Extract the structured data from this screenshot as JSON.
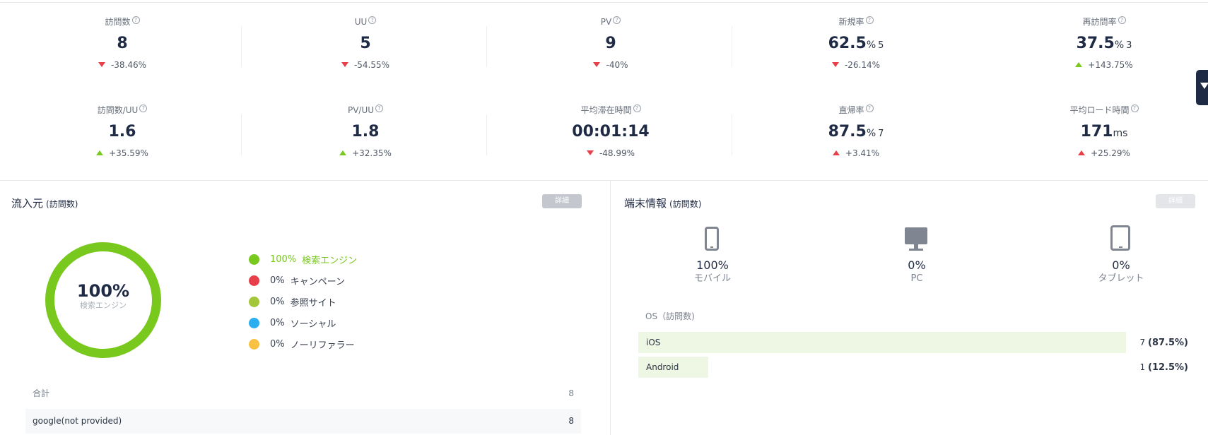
{
  "metrics": [
    {
      "label": "訪問数",
      "value": "8",
      "unit": "",
      "count": "",
      "change": "-38.46%",
      "trend": "down"
    },
    {
      "label": "UU",
      "value": "5",
      "unit": "",
      "count": "",
      "change": "-54.55%",
      "trend": "down"
    },
    {
      "label": "PV",
      "value": "9",
      "unit": "",
      "count": "",
      "change": "-40%",
      "trend": "down"
    },
    {
      "label": "新規率",
      "value": "62.5",
      "unit": "%",
      "count": "5",
      "change": "-26.14%",
      "trend": "down"
    },
    {
      "label": "再訪問率",
      "value": "37.5",
      "unit": "%",
      "count": "3",
      "change": "+143.75%",
      "trend": "up"
    },
    {
      "label": "訪問数/UU",
      "value": "1.6",
      "unit": "",
      "count": "",
      "change": "+35.59%",
      "trend": "up"
    },
    {
      "label": "PV/UU",
      "value": "1.8",
      "unit": "",
      "count": "",
      "change": "+32.35%",
      "trend": "up"
    },
    {
      "label": "平均滞在時間",
      "value": "00:01:14",
      "unit": "",
      "count": "",
      "change": "-48.99%",
      "trend": "down"
    },
    {
      "label": "直帰率",
      "value": "87.5",
      "unit": "%",
      "count": "7",
      "change": "+3.41%",
      "trend": "up-bad"
    },
    {
      "label": "平均ロード時間",
      "value": "171",
      "unit": "ms",
      "count": "",
      "change": "+25.29%",
      "trend": "up-bad"
    }
  ],
  "help_icon": "?",
  "colors": {
    "up": "#78c81e",
    "down": "#e8404a",
    "donut": "#78c81e"
  },
  "sources": {
    "title": "流入元",
    "subtitle": "(訪問数)",
    "detail_label": "詳細",
    "donut": {
      "percent": "100%",
      "label": "検索エンジン",
      "fill_fraction": 1.0
    },
    "legend": [
      {
        "percent": "100%",
        "label": "検索エンジン",
        "color": "#78c81e",
        "active": true
      },
      {
        "percent": "0%",
        "label": "キャンペーン",
        "color": "#e8404a",
        "active": false
      },
      {
        "percent": "0%",
        "label": "参照サイト",
        "color": "#a4c639",
        "active": false
      },
      {
        "percent": "0%",
        "label": "ソーシャル",
        "color": "#29aef0",
        "active": false
      },
      {
        "percent": "0%",
        "label": "ノーリファラー",
        "color": "#f8c142",
        "active": false
      }
    ],
    "total_label": "合計",
    "total_value": "8",
    "rows": [
      {
        "name": "google(not provided)",
        "value": "8"
      }
    ]
  },
  "devices": {
    "title": "端末情報",
    "subtitle": "(訪問数)",
    "detail_label": "詳細",
    "items": [
      {
        "icon": "mobile-icon",
        "percent": "100%",
        "name": "モバイル"
      },
      {
        "icon": "pc-icon",
        "percent": "0%",
        "name": "PC"
      },
      {
        "icon": "tablet-icon",
        "percent": "0%",
        "name": "タブレット"
      }
    ],
    "os_title": "OS（訪問数)",
    "os": [
      {
        "name": "iOS",
        "count": "7",
        "percent": "(87.5%)",
        "share": 0.875
      },
      {
        "name": "Android",
        "count": "1",
        "percent": "(12.5%)",
        "share": 0.125
      }
    ]
  }
}
